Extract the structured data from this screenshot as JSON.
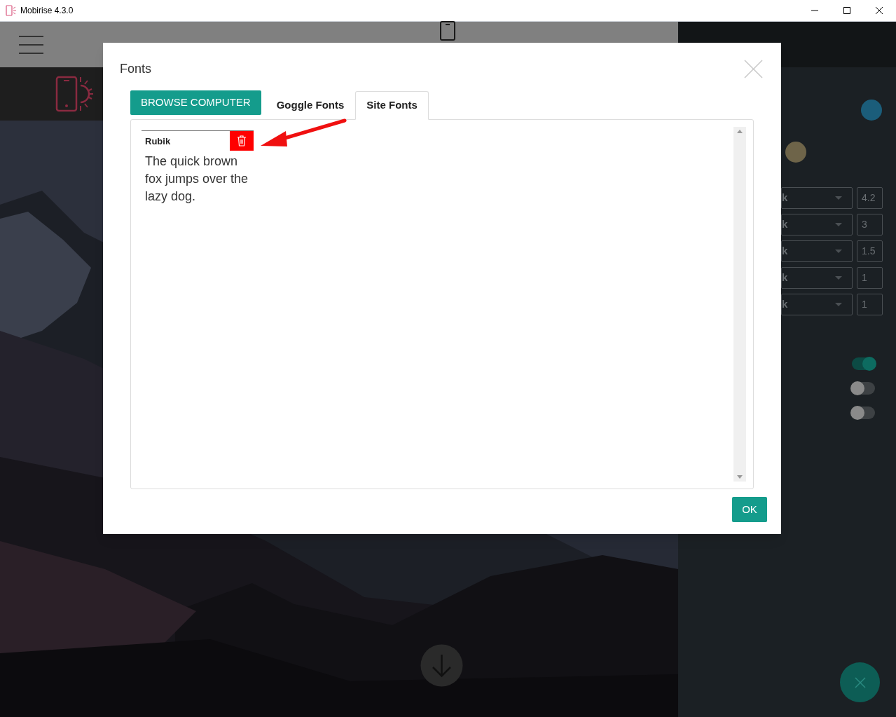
{
  "window": {
    "title": "Mobirise 4.3.0"
  },
  "dialog": {
    "title": "Fonts",
    "browse_button": "BROWSE COMPUTER",
    "tabs": [
      {
        "label": "Goggle Fonts",
        "selected": false
      },
      {
        "label": "Site Fonts",
        "selected": true
      }
    ],
    "fonts": [
      {
        "name": "Rubik",
        "sample": "The quick brown fox jumps over the lazy dog."
      }
    ],
    "ok_button": "OK"
  },
  "sidebar": {
    "colors": [
      {
        "color": "#1b5d7a"
      },
      {
        "color": "#6e6449"
      }
    ],
    "font_rows": [
      {
        "font": "k",
        "size": "4.2"
      },
      {
        "font": "k",
        "size": "3"
      },
      {
        "font": "k",
        "size": "1.5"
      },
      {
        "font": "k",
        "size": "1"
      },
      {
        "font": "k",
        "size": "1"
      }
    ],
    "toggles": [
      {
        "on": true
      },
      {
        "on": false
      },
      {
        "on": false
      }
    ]
  }
}
